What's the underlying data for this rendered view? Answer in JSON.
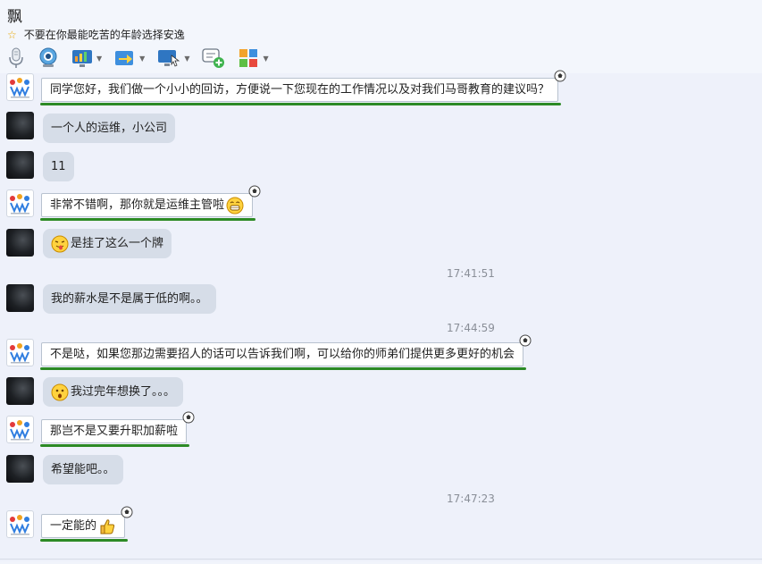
{
  "header": {
    "contact_name": "飘",
    "signature": "不要在你最能吃苦的年龄选择安逸"
  },
  "toolbar": {
    "items": [
      {
        "icon": "microphone-icon"
      },
      {
        "icon": "webcam-icon"
      },
      {
        "icon": "screen-share-icon"
      },
      {
        "icon": "send-file-icon"
      },
      {
        "icon": "remote-assist-icon"
      },
      {
        "icon": "message-add-icon"
      },
      {
        "icon": "apps-grid-icon"
      }
    ]
  },
  "chat": {
    "messages": [
      {
        "sender": "teacher",
        "text": "同学您好，我们做一个小小的回访，方便说一下您现在的工作情况以及对我们马哥教育的建议吗？"
      },
      {
        "sender": "student",
        "text": "一个人的运维，小公司"
      },
      {
        "sender": "student",
        "text": "11"
      },
      {
        "sender": "teacher",
        "text": "非常不错啊，那你就是运维主管啦",
        "emoji": "grin-emoji"
      },
      {
        "sender": "student",
        "text": "是挂了这么一个牌",
        "emoji": "tongue-emoji"
      },
      {
        "timestamp": "17:41:51"
      },
      {
        "sender": "student",
        "text": "我的薪水是不是属于低的啊。。"
      },
      {
        "timestamp": "17:44:59"
      },
      {
        "sender": "teacher",
        "text": "不是哒，如果您那边需要招人的话可以告诉我们啊，可以给你的师弟们提供更多更好的机会"
      },
      {
        "sender": "student",
        "text": "我过完年想换了。。。",
        "emoji": "surprised-emoji"
      },
      {
        "sender": "teacher",
        "text": "那岂不是又要升职加薪啦"
      },
      {
        "sender": "student",
        "text": "希望能吧。。"
      },
      {
        "timestamp": "17:47:23"
      },
      {
        "sender": "teacher",
        "text": "一定能的",
        "emoji": "thumbs-up-emoji"
      }
    ]
  },
  "colors": {
    "bubble_gray": "#d6dde8",
    "underline_green": "#2c8a25",
    "timestamp": "#8a8f98"
  }
}
